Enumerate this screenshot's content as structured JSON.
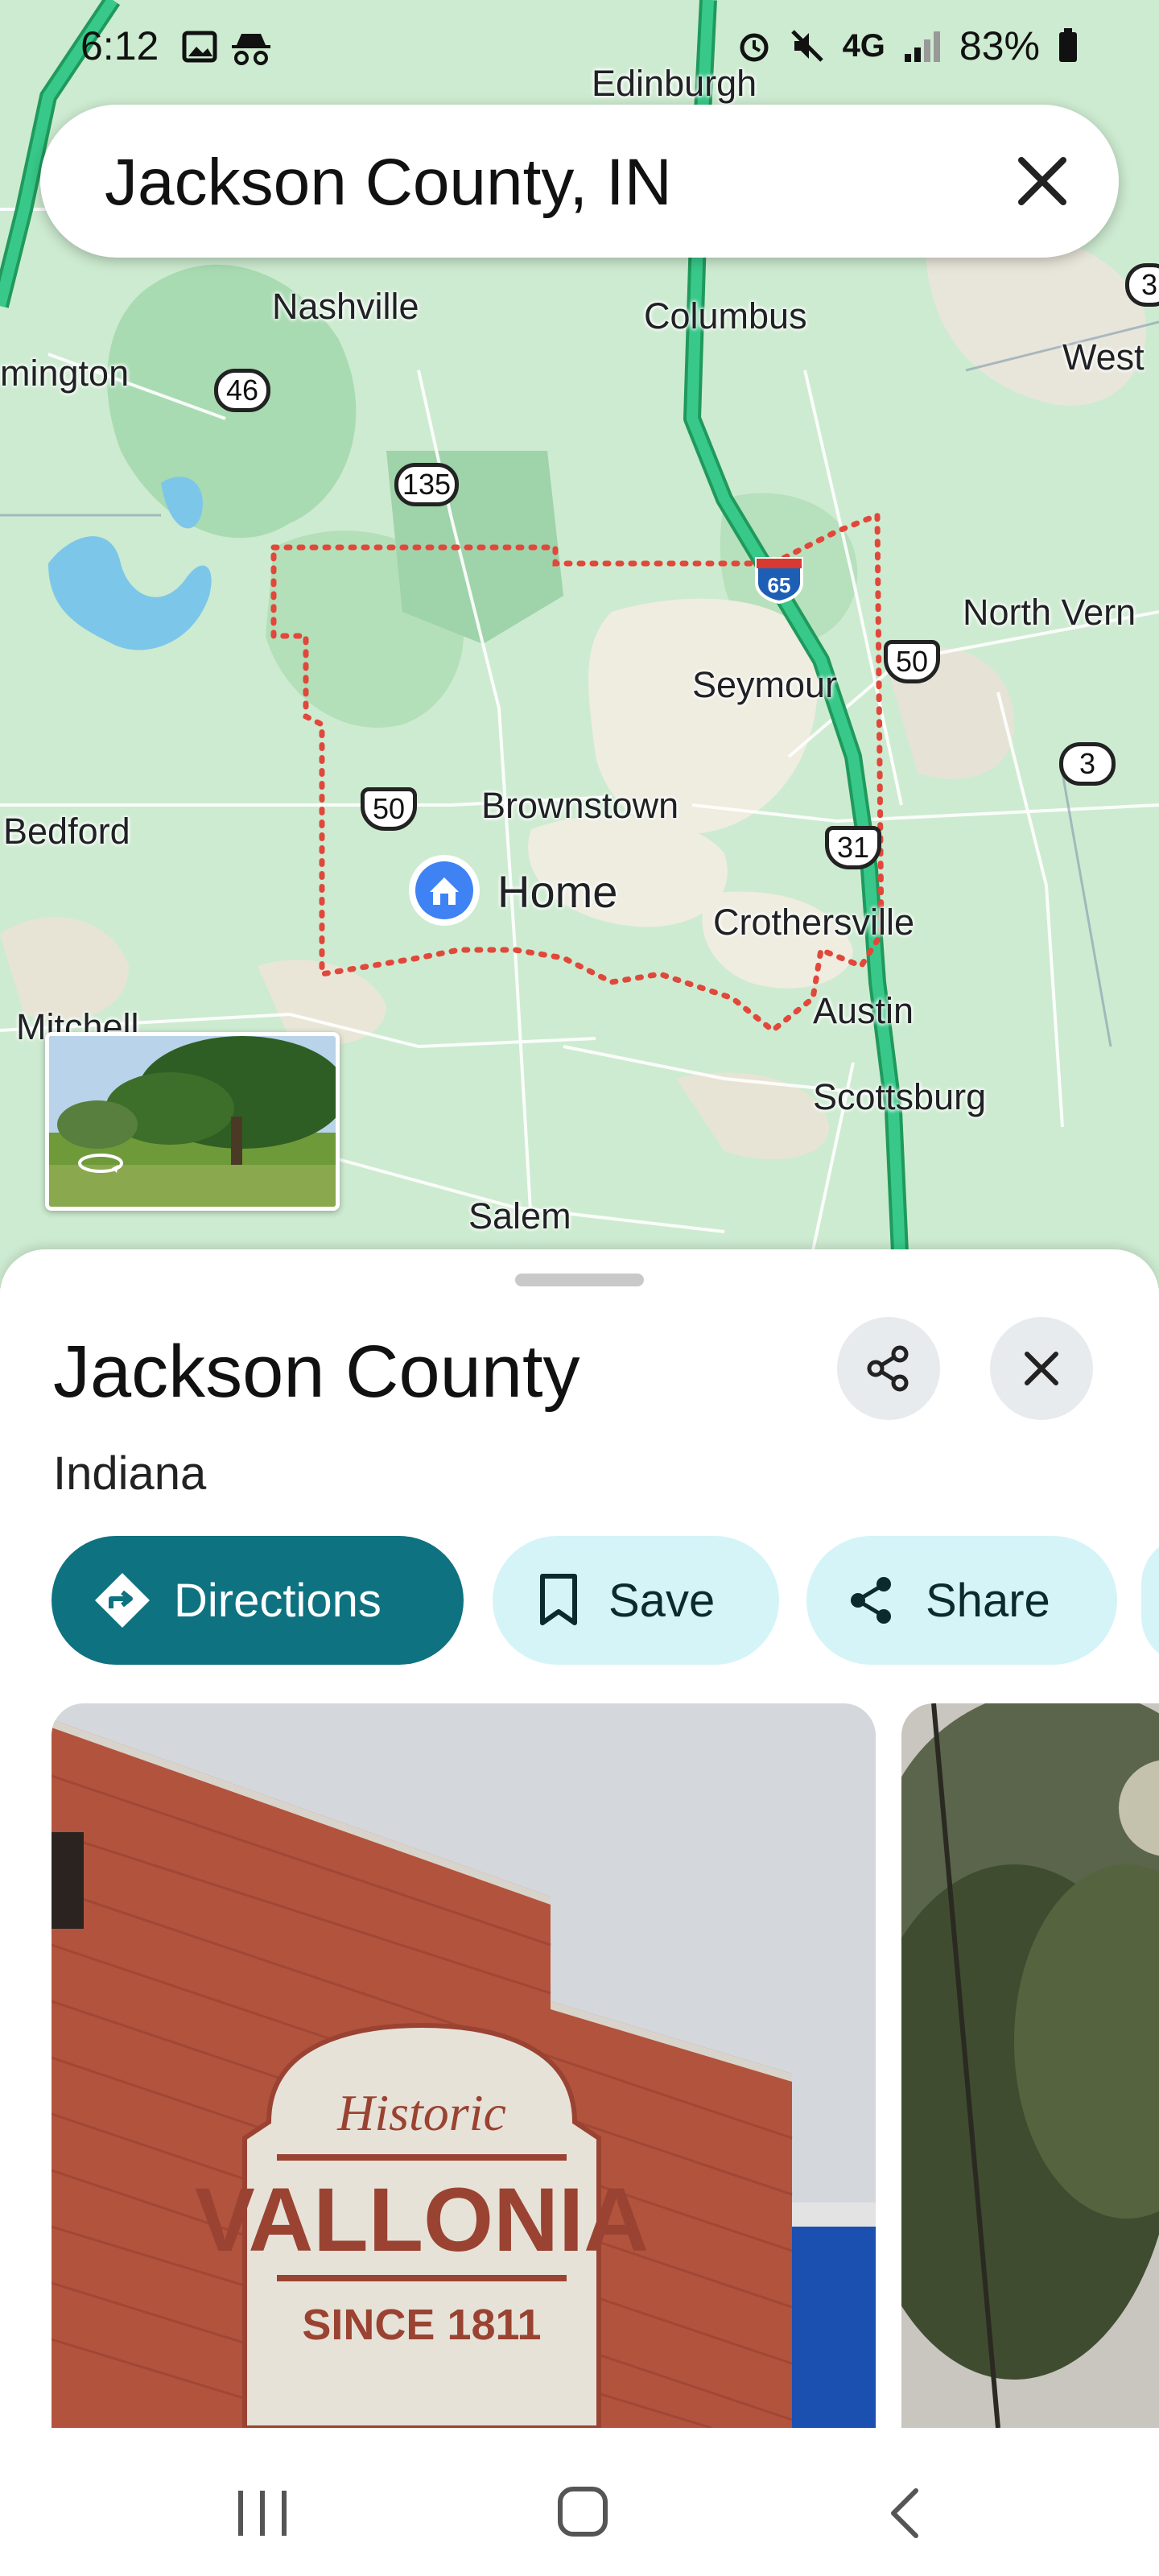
{
  "status_bar": {
    "time": "6:12",
    "network": "4G",
    "battery": "83%"
  },
  "search": {
    "query": "Jackson County, IN"
  },
  "map": {
    "places": [
      "Edinburgh",
      "Nashville",
      "Columbus",
      "mington",
      "West",
      "North Vern",
      "Seymour",
      "Brownstown",
      "Home",
      "Bedford",
      "Crothersville",
      "Mitchell",
      "Austin",
      "Scottsburg",
      "Salem"
    ],
    "routes": [
      "46",
      "135",
      "65",
      "50",
      "3",
      "50",
      "31",
      "3"
    ],
    "highlight_color": "#e0483b"
  },
  "place": {
    "title": "Jackson County",
    "subtitle": "Indiana"
  },
  "actions": {
    "directions": "Directions",
    "save": "Save",
    "share": "Share"
  },
  "photo": {
    "sign_top": "Historic",
    "sign_main": "VALLONIA",
    "sign_bottom": "SINCE 1811"
  },
  "colors": {
    "accent": "#0e7280",
    "chip_bg": "#d4f4f8",
    "highway": "#2fbf7a"
  }
}
